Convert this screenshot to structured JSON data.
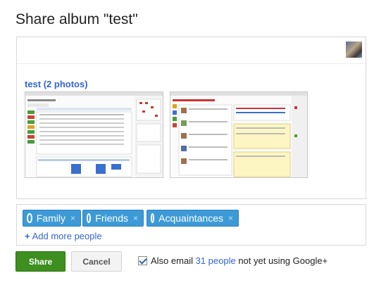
{
  "dialog": {
    "title": "Share album \"test\""
  },
  "album": {
    "link_label": "test (2 photos)"
  },
  "audience": {
    "chips": [
      {
        "label": "Family",
        "remove_icon": "×"
      },
      {
        "label": "Friends",
        "remove_icon": "×"
      },
      {
        "label": "Acquaintances",
        "remove_icon": "×"
      }
    ],
    "add_more_plus": "+",
    "add_more_label": "Add more people"
  },
  "buttons": {
    "share": "Share",
    "cancel": "Cancel"
  },
  "email": {
    "checked": true,
    "prefix": "Also email ",
    "link": "31 people",
    "suffix": " not yet using Google+"
  },
  "colors": {
    "accent_blue": "#3366cc",
    "chip_blue": "#3d9ad6",
    "share_green": "#3d8f1f"
  },
  "icons": [
    "user-avatar",
    "circle-icon",
    "remove-x-icon",
    "checkbox-checked"
  ]
}
